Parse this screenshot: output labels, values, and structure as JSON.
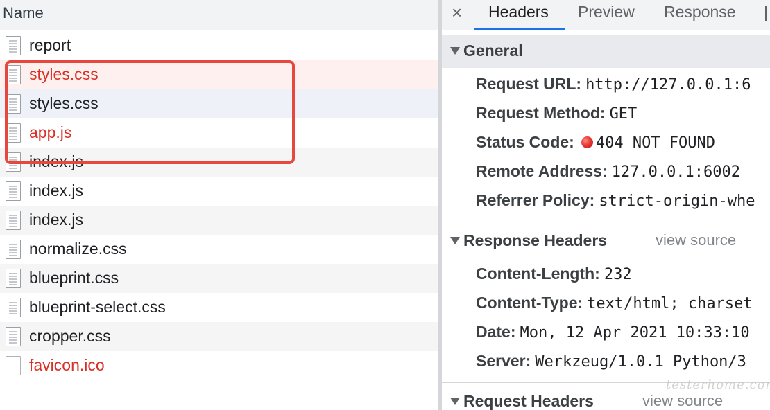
{
  "request_list": {
    "column_header": "Name",
    "rows": [
      {
        "name": "report",
        "status": "ok"
      },
      {
        "name": "styles.css",
        "status": "error"
      },
      {
        "name": "styles.css",
        "status": "selected"
      },
      {
        "name": "app.js",
        "status": "error"
      },
      {
        "name": "index.js",
        "status": "ok"
      },
      {
        "name": "index.js",
        "status": "ok"
      },
      {
        "name": "index.js",
        "status": "ok"
      },
      {
        "name": "normalize.css",
        "status": "ok"
      },
      {
        "name": "blueprint.css",
        "status": "ok"
      },
      {
        "name": "blueprint-select.css",
        "status": "ok"
      },
      {
        "name": "cropper.css",
        "status": "ok"
      },
      {
        "name": "favicon.ico",
        "status": "error"
      }
    ]
  },
  "tabs": {
    "close": "×",
    "items": [
      "Headers",
      "Preview",
      "Response"
    ],
    "active": "Headers"
  },
  "general": {
    "title": "General",
    "request_url": {
      "key": "Request URL:",
      "value": "http://127.0.0.1:6"
    },
    "request_method": {
      "key": "Request Method:",
      "value": "GET"
    },
    "status_code": {
      "key": "Status Code:",
      "value": "404 NOT FOUND"
    },
    "remote_address": {
      "key": "Remote Address:",
      "value": "127.0.0.1:6002"
    },
    "referrer_policy": {
      "key": "Referrer Policy:",
      "value": "strict-origin-whe"
    }
  },
  "response_headers": {
    "title": "Response Headers",
    "view_source": "view source",
    "content_length": {
      "key": "Content-Length:",
      "value": "232"
    },
    "content_type": {
      "key": "Content-Type:",
      "value": "text/html; charset"
    },
    "date": {
      "key": "Date:",
      "value": "Mon, 12 Apr 2021 10:33:10"
    },
    "server": {
      "key": "Server:",
      "value": "Werkzeug/1.0.1 Python/3"
    }
  },
  "request_headers": {
    "title": "Request Headers",
    "view_source": "view source"
  },
  "watermark": "testerhome.com",
  "colors": {
    "error_text": "#d93025",
    "highlight": "#e8473d",
    "active_tab": "#1a73e8"
  }
}
